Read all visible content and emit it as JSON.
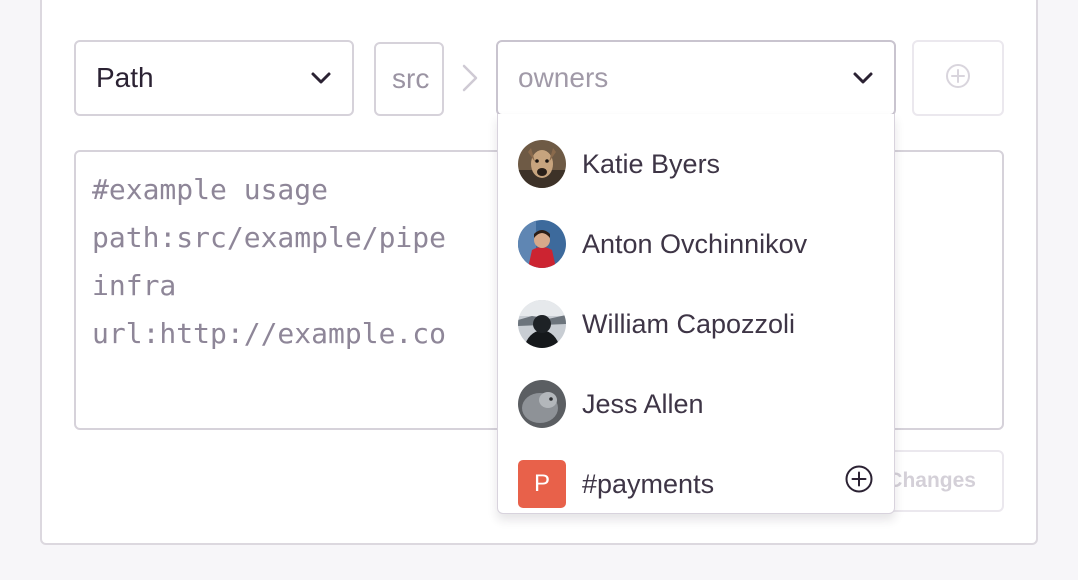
{
  "rule_form": {
    "type_select": {
      "value": "Path"
    },
    "value_input": {
      "value": "src"
    },
    "owners_select": {
      "placeholder": "owners"
    },
    "rules_textarea": {
      "text": "#example usage\npath:src/example/pipe                   io #\ninfra\nurl:http://example.co"
    },
    "save_button": {
      "label": "Save Changes"
    }
  },
  "owners_dropdown": {
    "options": [
      {
        "label": "Katie Byers",
        "kind": "user"
      },
      {
        "label": "Anton Ovchinnikov",
        "kind": "user"
      },
      {
        "label": "William Capozzoli",
        "kind": "user"
      },
      {
        "label": "Jess Allen",
        "kind": "user"
      },
      {
        "label": "#payments",
        "kind": "team",
        "badge": "P",
        "badge_color": "#e8614a",
        "action_icon": "add-circle-icon"
      }
    ]
  },
  "colors": {
    "page_bg": "#f7f6f9",
    "border": "#d6d2da",
    "text": "#2b2233",
    "placeholder": "#a19aa8",
    "team_badge": "#e8614a"
  }
}
